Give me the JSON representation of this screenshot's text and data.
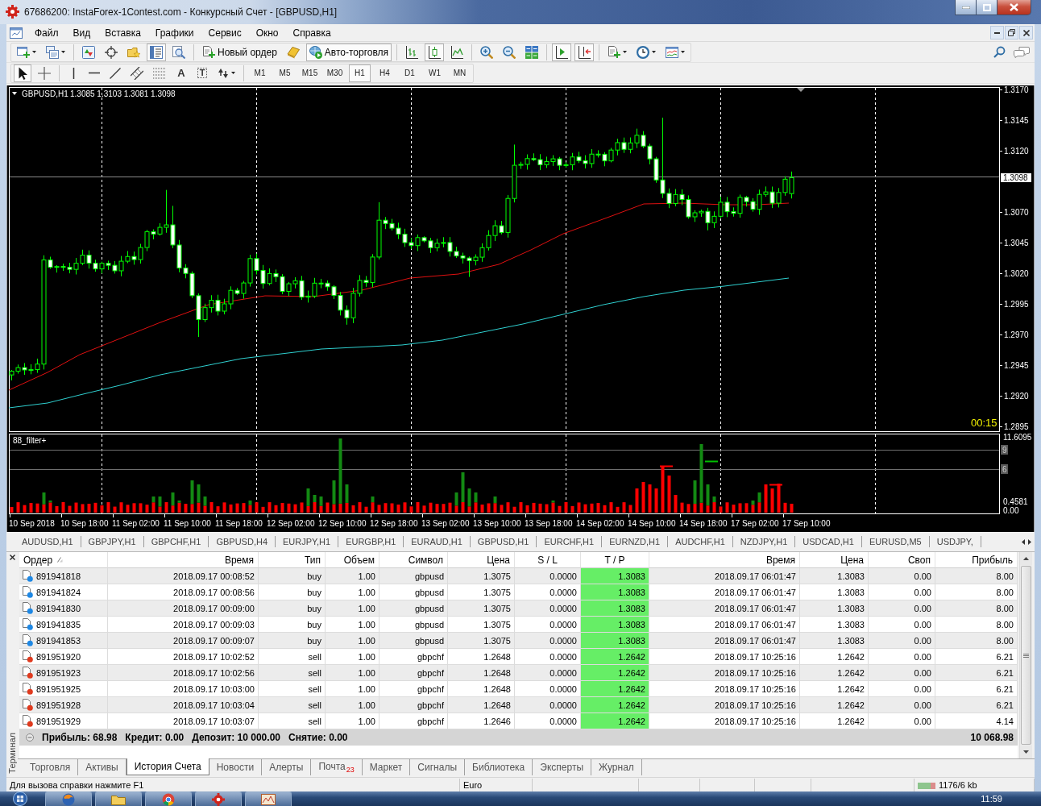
{
  "window": {
    "title": "67686200: InstaForex-1Contest.com - Конкурсный Счет - [GBPUSD,H1]"
  },
  "menu": [
    "Файл",
    "Вид",
    "Вставка",
    "Графики",
    "Сервис",
    "Окно",
    "Справка"
  ],
  "toolbar_main": [
    [
      {
        "kind": "new-chart",
        "pressed": false,
        "dropdown": true
      },
      {
        "kind": "profiles",
        "pressed": false,
        "dropdown": true
      }
    ],
    [
      {
        "kind": "market-watch",
        "pressed": false,
        "dropdown": false
      },
      {
        "kind": "data-window",
        "pressed": false,
        "dropdown": false
      },
      {
        "kind": "navigator",
        "pressed": false,
        "dropdown": false
      },
      {
        "kind": "terminal",
        "pressed": true,
        "dropdown": false
      },
      {
        "kind": "tester",
        "pressed": false,
        "dropdown": false
      }
    ],
    [
      {
        "kind": "new-order",
        "label": "Новый ордер",
        "pressed": false,
        "dropdown": false
      },
      {
        "kind": "meta-editor",
        "pressed": false,
        "dropdown": false
      },
      {
        "kind": "auto-trading",
        "label": "Авто-торговля",
        "pressed": true,
        "dropdown": false
      }
    ],
    [
      {
        "kind": "bar-chart",
        "pressed": false,
        "dropdown": false
      },
      {
        "kind": "candle-chart",
        "pressed": true,
        "dropdown": false
      },
      {
        "kind": "line-chart",
        "pressed": false,
        "dropdown": false
      }
    ],
    [
      {
        "kind": "zoom-in",
        "pressed": false,
        "dropdown": false
      },
      {
        "kind": "zoom-out",
        "pressed": false,
        "dropdown": false
      },
      {
        "kind": "tile",
        "pressed": false,
        "dropdown": false
      }
    ],
    [
      {
        "kind": "auto-scroll",
        "pressed": true,
        "dropdown": false
      },
      {
        "kind": "chart-shift",
        "pressed": true,
        "dropdown": false
      }
    ],
    [
      {
        "kind": "indicators",
        "pressed": false,
        "dropdown": true
      },
      {
        "kind": "periods",
        "pressed": false,
        "dropdown": true
      },
      {
        "kind": "templates",
        "pressed": false,
        "dropdown": true
      }
    ]
  ],
  "toolbar_tools": [
    [
      {
        "kind": "cursor",
        "pressed": true,
        "dropdown": false
      },
      {
        "kind": "crosshair",
        "pressed": false,
        "dropdown": false
      }
    ],
    [
      {
        "kind": "vline",
        "pressed": false,
        "dropdown": false
      },
      {
        "kind": "hline",
        "pressed": false,
        "dropdown": false
      },
      {
        "kind": "trendline",
        "pressed": false,
        "dropdown": false
      },
      {
        "kind": "channel",
        "pressed": false,
        "dropdown": false
      },
      {
        "kind": "fibonacci",
        "pressed": false,
        "dropdown": false
      },
      {
        "kind": "text",
        "label": "A",
        "pressed": false,
        "dropdown": false
      },
      {
        "kind": "label",
        "label": "T",
        "pressed": false,
        "dropdown": false
      },
      {
        "kind": "arrows",
        "pressed": false,
        "dropdown": true
      }
    ]
  ],
  "timeframes": [
    {
      "label": "M1",
      "selected": false
    },
    {
      "label": "M5",
      "selected": false
    },
    {
      "label": "M15",
      "selected": false
    },
    {
      "label": "M30",
      "selected": false
    },
    {
      "label": "H1",
      "selected": true
    },
    {
      "label": "H4",
      "selected": false
    },
    {
      "label": "D1",
      "selected": false
    },
    {
      "label": "W1",
      "selected": false
    },
    {
      "label": "MN",
      "selected": false
    }
  ],
  "chart": {
    "symbol": "GBPUSD,H1",
    "ohlc": "1.3085 1.3103 1.3081 1.3098",
    "price_ticks": [
      {
        "label": "1.3170",
        "current": false
      },
      {
        "label": "1.3145",
        "current": false
      },
      {
        "label": "1.3120",
        "current": false
      },
      {
        "label": "1.3098",
        "current": true
      },
      {
        "label": "1.3070",
        "current": false
      },
      {
        "label": "1.3045",
        "current": false
      },
      {
        "label": "1.3020",
        "current": false
      },
      {
        "label": "1.2995",
        "current": false
      },
      {
        "label": "1.2970",
        "current": false
      },
      {
        "label": "1.2945",
        "current": false
      },
      {
        "label": "1.2920",
        "current": false
      },
      {
        "label": "1.2895",
        "current": false
      }
    ],
    "timer": "00:15",
    "indicator": {
      "name": "88_filter+",
      "ticks": [
        {
          "label": "11.6095",
          "kind": "value"
        },
        {
          "label": "9",
          "kind": "level"
        },
        {
          "label": "6",
          "kind": "level"
        },
        {
          "label": "0.4581",
          "kind": "value"
        },
        {
          "label": "0.00",
          "kind": "value"
        }
      ]
    },
    "time_labels": [
      "10 Sep 2018",
      "10 Sep 18:00",
      "11 Sep 02:00",
      "11 Sep 10:00",
      "11 Sep 18:00",
      "12 Sep 02:00",
      "12 Sep 10:00",
      "12 Sep 18:00",
      "13 Sep 02:00",
      "13 Sep 10:00",
      "13 Sep 18:00",
      "14 Sep 02:00",
      "14 Sep 10:00",
      "14 Sep 18:00",
      "17 Sep 02:00",
      "17 Sep 10:00"
    ]
  },
  "chart_tabs": [
    "AUDUSD,H1",
    "GBPJPY,H1",
    "GBPCHF,H1",
    "GBPUSD,H4",
    "EURJPY,H1",
    "EURGBP,H1",
    "EURAUD,H1",
    "GBPUSD,H1",
    "EURCHF,H1",
    "EURNZD,H1",
    "AUDCHF,H1",
    "NZDJPY,H1",
    "USDCAD,H1",
    "EURUSD,M5",
    "USDJPY,"
  ],
  "terminal": {
    "side_label": "Терминал",
    "columns": [
      "Ордер",
      "Время",
      "Тип",
      "Объем",
      "Символ",
      "Цена",
      "S / L",
      "T / P",
      "Время",
      "Цена",
      "Своп",
      "Прибыль"
    ],
    "rows": [
      {
        "order": "891941818",
        "color": "#1e88e5",
        "open_time": "2018.09.17 00:08:52",
        "type": "buy",
        "volume": "1.00",
        "symbol": "gbpusd",
        "open_price": "1.3075",
        "sl": "0.0000",
        "tp": "1.3083",
        "tp_hit": true,
        "close_time": "2018.09.17 06:01:47",
        "close_price": "1.3083",
        "swap": "0.00",
        "profit": "8.00"
      },
      {
        "order": "891941824",
        "color": "#1e88e5",
        "open_time": "2018.09.17 00:08:56",
        "type": "buy",
        "volume": "1.00",
        "symbol": "gbpusd",
        "open_price": "1.3075",
        "sl": "0.0000",
        "tp": "1.3083",
        "tp_hit": true,
        "close_time": "2018.09.17 06:01:47",
        "close_price": "1.3083",
        "swap": "0.00",
        "profit": "8.00"
      },
      {
        "order": "891941830",
        "color": "#1e88e5",
        "open_time": "2018.09.17 00:09:00",
        "type": "buy",
        "volume": "1.00",
        "symbol": "gbpusd",
        "open_price": "1.3075",
        "sl": "0.0000",
        "tp": "1.3083",
        "tp_hit": true,
        "close_time": "2018.09.17 06:01:47",
        "close_price": "1.3083",
        "swap": "0.00",
        "profit": "8.00"
      },
      {
        "order": "891941835",
        "color": "#1e88e5",
        "open_time": "2018.09.17 00:09:03",
        "type": "buy",
        "volume": "1.00",
        "symbol": "gbpusd",
        "open_price": "1.3075",
        "sl": "0.0000",
        "tp": "1.3083",
        "tp_hit": true,
        "close_time": "2018.09.17 06:01:47",
        "close_price": "1.3083",
        "swap": "0.00",
        "profit": "8.00"
      },
      {
        "order": "891941853",
        "color": "#1e88e5",
        "open_time": "2018.09.17 00:09:07",
        "type": "buy",
        "volume": "1.00",
        "symbol": "gbpusd",
        "open_price": "1.3075",
        "sl": "0.0000",
        "tp": "1.3083",
        "tp_hit": true,
        "close_time": "2018.09.17 06:01:47",
        "close_price": "1.3083",
        "swap": "0.00",
        "profit": "8.00"
      },
      {
        "order": "891951920",
        "color": "#e03a1e",
        "open_time": "2018.09.17 10:02:52",
        "type": "sell",
        "volume": "1.00",
        "symbol": "gbpchf",
        "open_price": "1.2648",
        "sl": "0.0000",
        "tp": "1.2642",
        "tp_hit": true,
        "close_time": "2018.09.17 10:25:16",
        "close_price": "1.2642",
        "swap": "0.00",
        "profit": "6.21"
      },
      {
        "order": "891951923",
        "color": "#e03a1e",
        "open_time": "2018.09.17 10:02:56",
        "type": "sell",
        "volume": "1.00",
        "symbol": "gbpchf",
        "open_price": "1.2648",
        "sl": "0.0000",
        "tp": "1.2642",
        "tp_hit": true,
        "close_time": "2018.09.17 10:25:16",
        "close_price": "1.2642",
        "swap": "0.00",
        "profit": "6.21"
      },
      {
        "order": "891951925",
        "color": "#e03a1e",
        "open_time": "2018.09.17 10:03:00",
        "type": "sell",
        "volume": "1.00",
        "symbol": "gbpchf",
        "open_price": "1.2648",
        "sl": "0.0000",
        "tp": "1.2642",
        "tp_hit": true,
        "close_time": "2018.09.17 10:25:16",
        "close_price": "1.2642",
        "swap": "0.00",
        "profit": "6.21"
      },
      {
        "order": "891951928",
        "color": "#e03a1e",
        "open_time": "2018.09.17 10:03:04",
        "type": "sell",
        "volume": "1.00",
        "symbol": "gbpchf",
        "open_price": "1.2648",
        "sl": "0.0000",
        "tp": "1.2642",
        "tp_hit": true,
        "close_time": "2018.09.17 10:25:16",
        "close_price": "1.2642",
        "swap": "0.00",
        "profit": "6.21"
      },
      {
        "order": "891951929",
        "color": "#e03a1e",
        "open_time": "2018.09.17 10:03:07",
        "type": "sell",
        "volume": "1.00",
        "symbol": "gbpchf",
        "open_price": "1.2646",
        "sl": "0.0000",
        "tp": "1.2642",
        "tp_hit": true,
        "close_time": "2018.09.17 10:25:16",
        "close_price": "1.2642",
        "swap": "0.00",
        "profit": "4.14"
      }
    ],
    "summary": [
      "Прибыль: 68.98",
      "Кредит: 0.00",
      "Депозит: 10 000.00",
      "Снятие: 0.00"
    ],
    "total": "10 068.98"
  },
  "terminal_tabs": [
    {
      "label": "Торговля",
      "selected": false
    },
    {
      "label": "Активы",
      "selected": false
    },
    {
      "label": "История Счета",
      "selected": true
    },
    {
      "label": "Новости",
      "selected": false
    },
    {
      "label": "Алерты",
      "selected": false
    },
    {
      "label": "Почта",
      "badge": "23",
      "selected": false
    },
    {
      "label": "Маркет",
      "selected": false
    },
    {
      "label": "Сигналы",
      "selected": false
    },
    {
      "label": "Библиотека",
      "selected": false
    },
    {
      "label": "Эксперты",
      "selected": false
    },
    {
      "label": "Журнал",
      "selected": false
    }
  ],
  "status_bar": {
    "hint": "Для вызова справки нажмите F1",
    "profile": "Euro",
    "traffic": "1176/6 kb"
  },
  "taskbar": {
    "clock": "11:59"
  }
}
